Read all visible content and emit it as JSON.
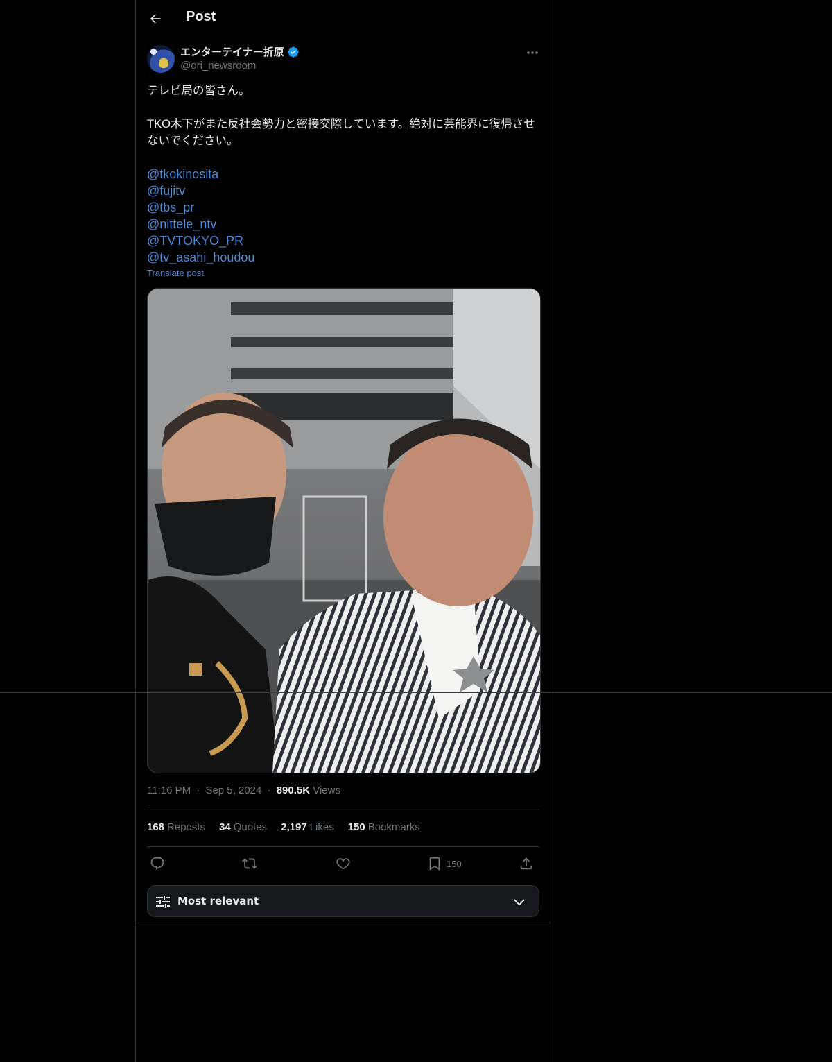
{
  "header": {
    "title": "Post"
  },
  "author": {
    "name": "エンターテイナー折原",
    "handle": "@ori_newsroom",
    "verified": true
  },
  "post": {
    "paragraphs": [
      "テレビ局の皆さん。",
      "TKO木下がまた反社会勢力と密接交際しています。絶対に芸能界に復帰させないでください。"
    ],
    "mentions": [
      "@tkokinosita",
      "@fujitv",
      "@tbs_pr",
      "@nittele_ntv",
      "@TVTOKYO_PR",
      "@tv_asahi_houdou"
    ],
    "translate_label": "Translate post"
  },
  "meta": {
    "time": "11:16 PM",
    "date": "Sep 5, 2024",
    "views": "890.5K",
    "views_label": "Views",
    "sep": "·"
  },
  "stats": {
    "reposts": "168",
    "reposts_label": "Reposts",
    "quotes": "34",
    "quotes_label": "Quotes",
    "likes": "2,197",
    "likes_label": "Likes",
    "bookmarks": "150",
    "bookmarks_label": "Bookmarks"
  },
  "actions": {
    "bookmark_count": "150"
  },
  "sort": {
    "label": "Most relevant"
  },
  "colors": {
    "background": "#000000",
    "text": "#e7e9ea",
    "muted": "#71767b",
    "link": "#4a8ad9",
    "verified": "#1d9bf0",
    "border": "#2f3336"
  }
}
